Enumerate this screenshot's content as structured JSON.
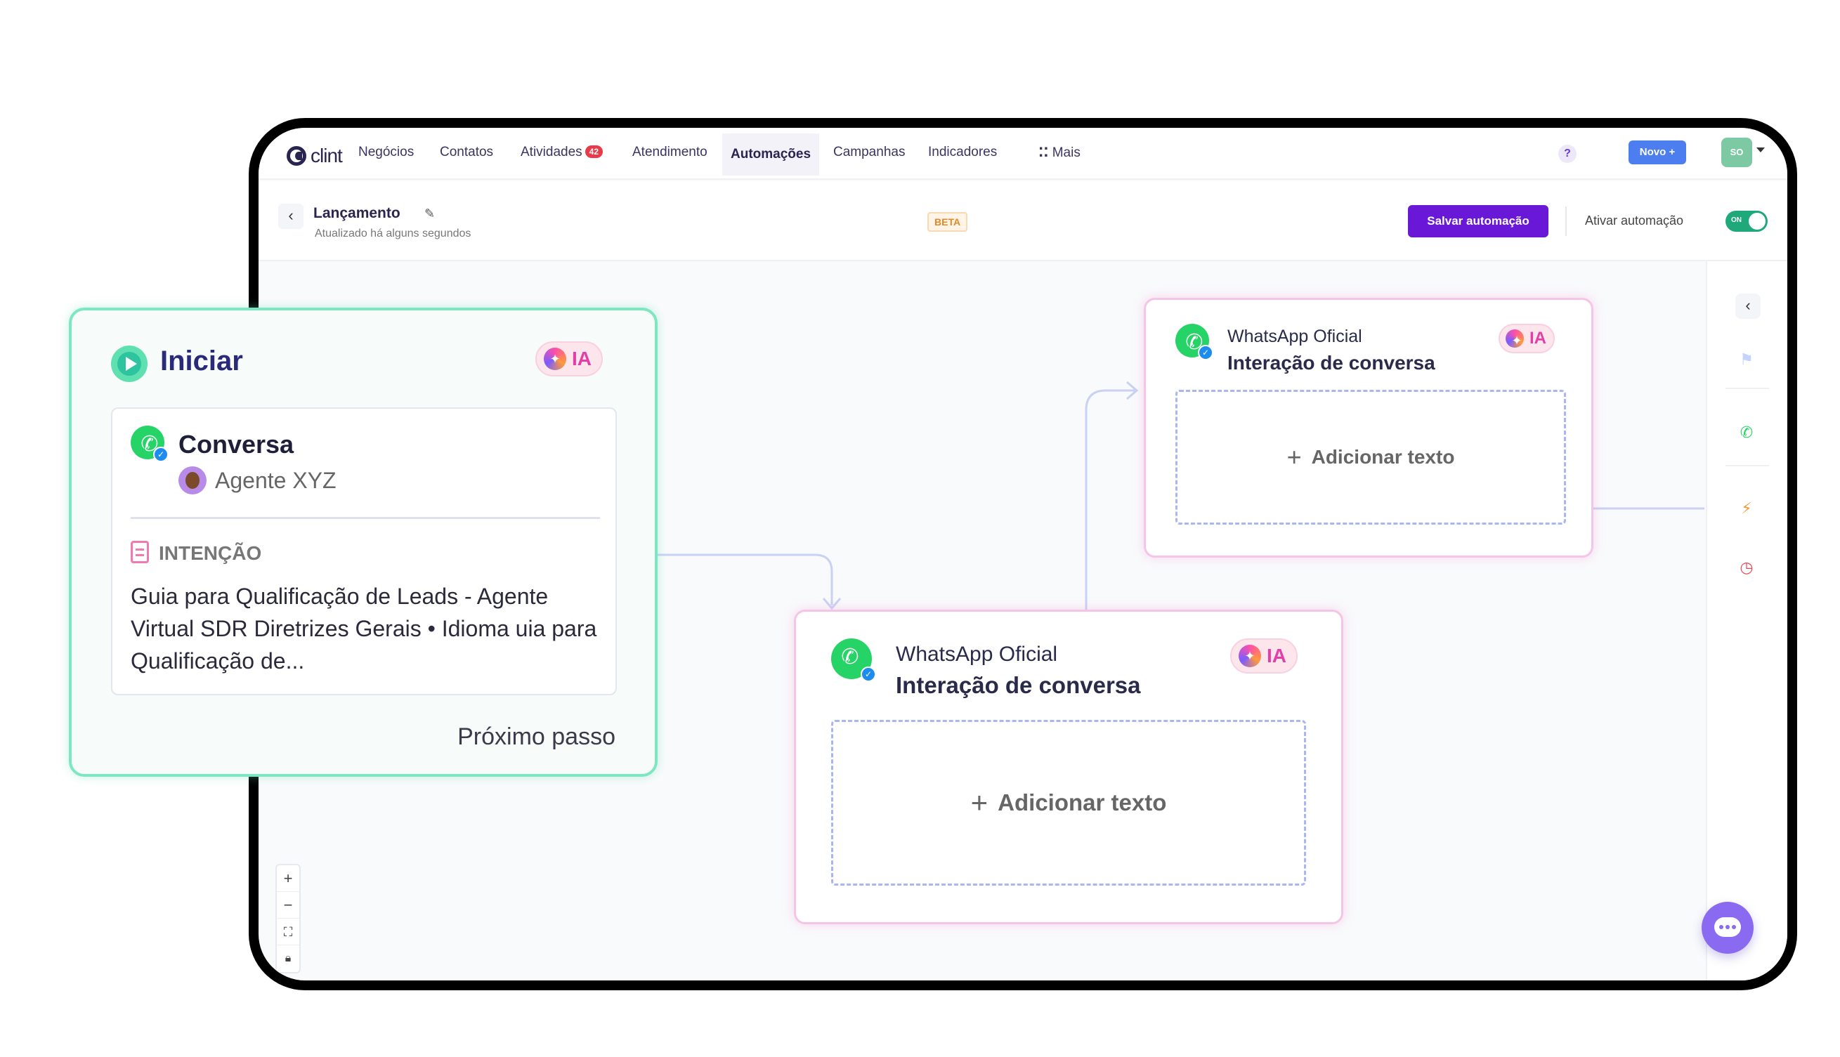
{
  "app": {
    "logo_text": "clint",
    "nav": [
      {
        "label": "Negócios"
      },
      {
        "label": "Contatos"
      },
      {
        "label": "Atividades",
        "badge": "42"
      },
      {
        "label": "Atendimento"
      },
      {
        "label": "Automações",
        "active": true
      },
      {
        "label": "Campanhas"
      },
      {
        "label": "Indicadores"
      },
      {
        "label": "Mais",
        "icon": "grid-dots-icon"
      }
    ],
    "help": "?",
    "new_button": "Novo +",
    "user_initials": "SO"
  },
  "header": {
    "title": "Lançamento",
    "updated": "Atualizado há alguns segundos",
    "beta": "BETA",
    "save_button": "Salvar automação",
    "activate_label": "Ativar automação",
    "toggle_text": "ON",
    "toggle_on": true
  },
  "start_card": {
    "title": "Iniciar",
    "ia_label": "IA",
    "conversation_title": "Conversa",
    "agent_name": "Agente XYZ",
    "intent_label": "INTENÇÃO",
    "intent_text": "Guia para Qualificação de Leads - Agente Virtual SDR  Diretrizes Gerais  • Idioma uia para Qualificação de...",
    "next_step": "Próximo passo"
  },
  "wa_card_top": {
    "channel": "WhatsApp Oficial",
    "action": "Interação de conversa",
    "ia_label": "IA",
    "add_text": "Adicionar texto"
  },
  "wa_card_bottom": {
    "channel": "WhatsApp Oficial",
    "action": "Interação de conversa",
    "ia_label": "IA",
    "add_text": "Adicionar texto"
  },
  "colors": {
    "primary": "#6a18d8",
    "accent_blue": "#4d7ef0",
    "start_border": "#6fe2b8",
    "wa_border": "#f6c4e6",
    "ia_pink": "#e33ea8",
    "whatsapp_green": "#25d366",
    "toggle_green": "#1fa87a"
  },
  "icons": [
    "clint-logo-icon",
    "back-icon",
    "pencil-icon",
    "play-icon",
    "whatsapp-icon",
    "sparkle-icon",
    "document-icon",
    "plus-icon",
    "flag-icon",
    "bolt-icon",
    "timer-icon",
    "chevron-left-icon",
    "chat-icon",
    "zoom-in-icon",
    "zoom-out-icon",
    "fit-view-icon",
    "lock-icon"
  ]
}
